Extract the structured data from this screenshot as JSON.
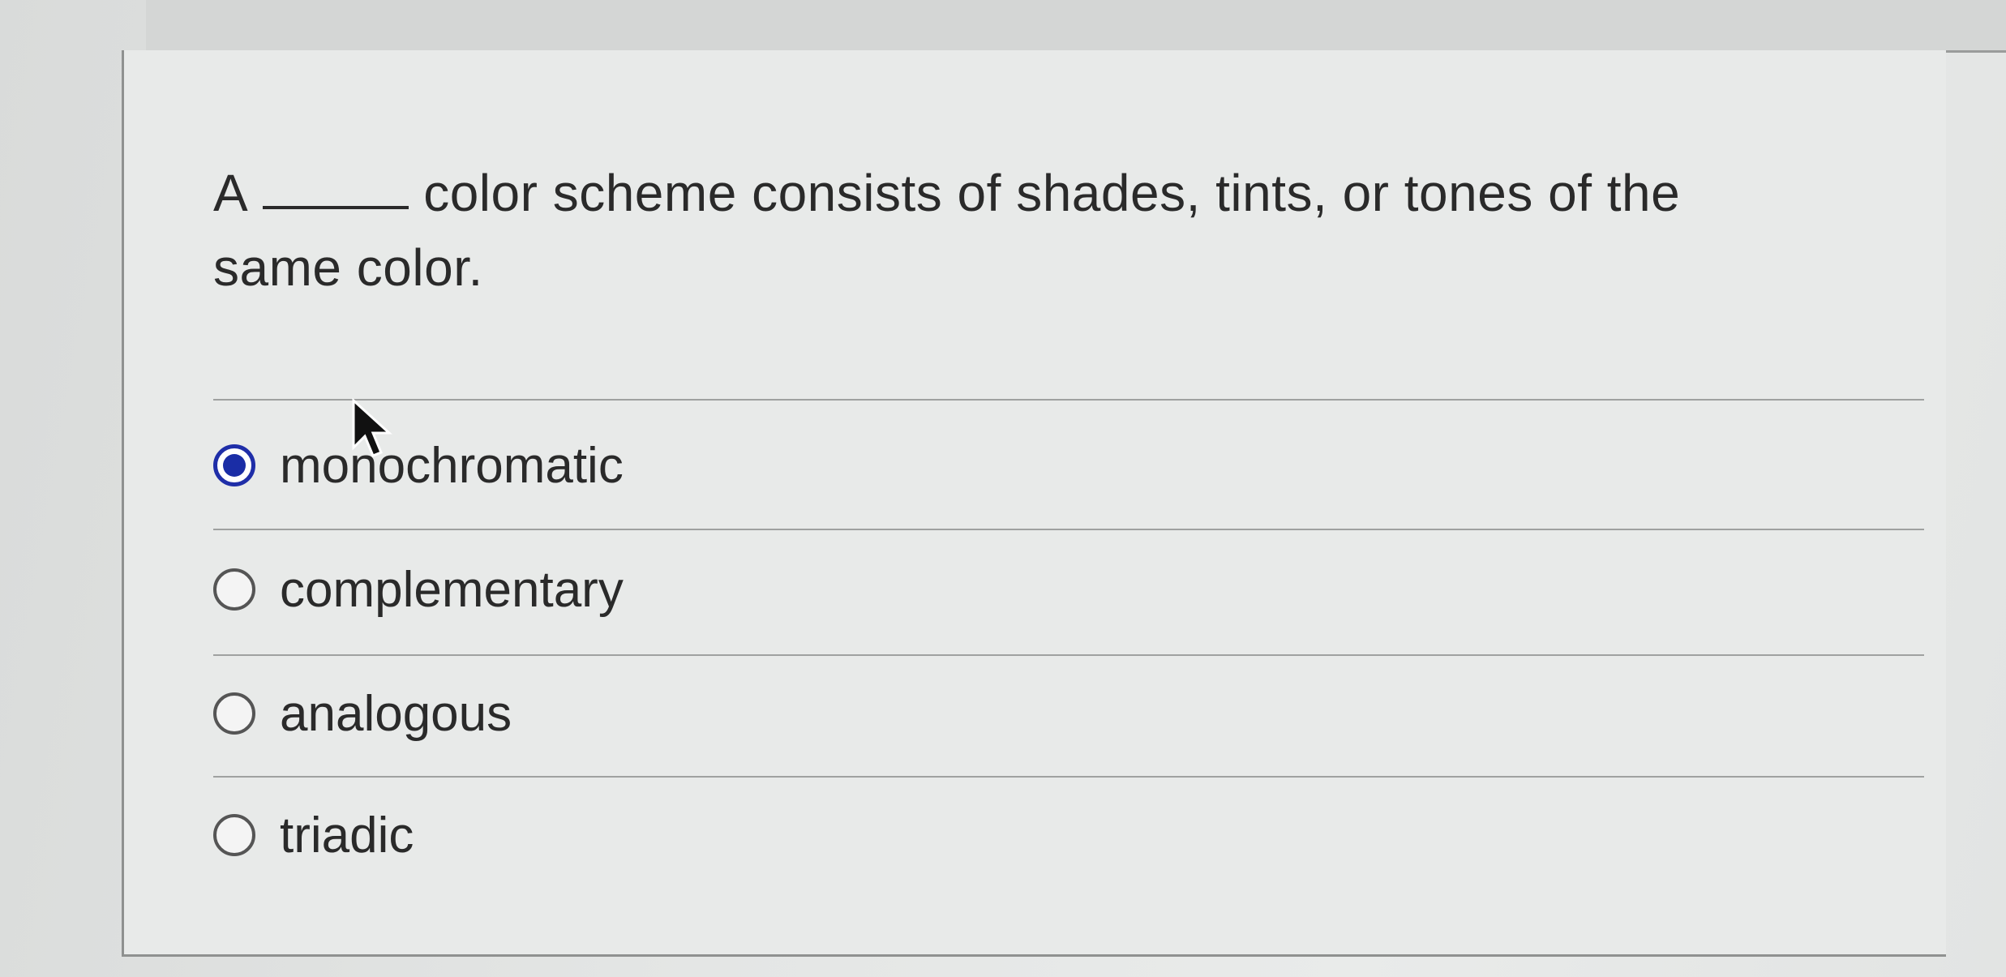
{
  "question": {
    "prefix": "A",
    "suffix_line1": "color scheme consists of shades, tints, or tones of the",
    "suffix_line2": "same color."
  },
  "options": [
    {
      "label": "monochromatic",
      "selected": true
    },
    {
      "label": "complementary",
      "selected": false
    },
    {
      "label": "analogous",
      "selected": false
    },
    {
      "label": "triadic",
      "selected": false
    }
  ],
  "colors": {
    "accent": "#1a2da6",
    "text": "#2a2a2a"
  },
  "icons": {
    "cursor": "mouse-pointer-icon"
  }
}
